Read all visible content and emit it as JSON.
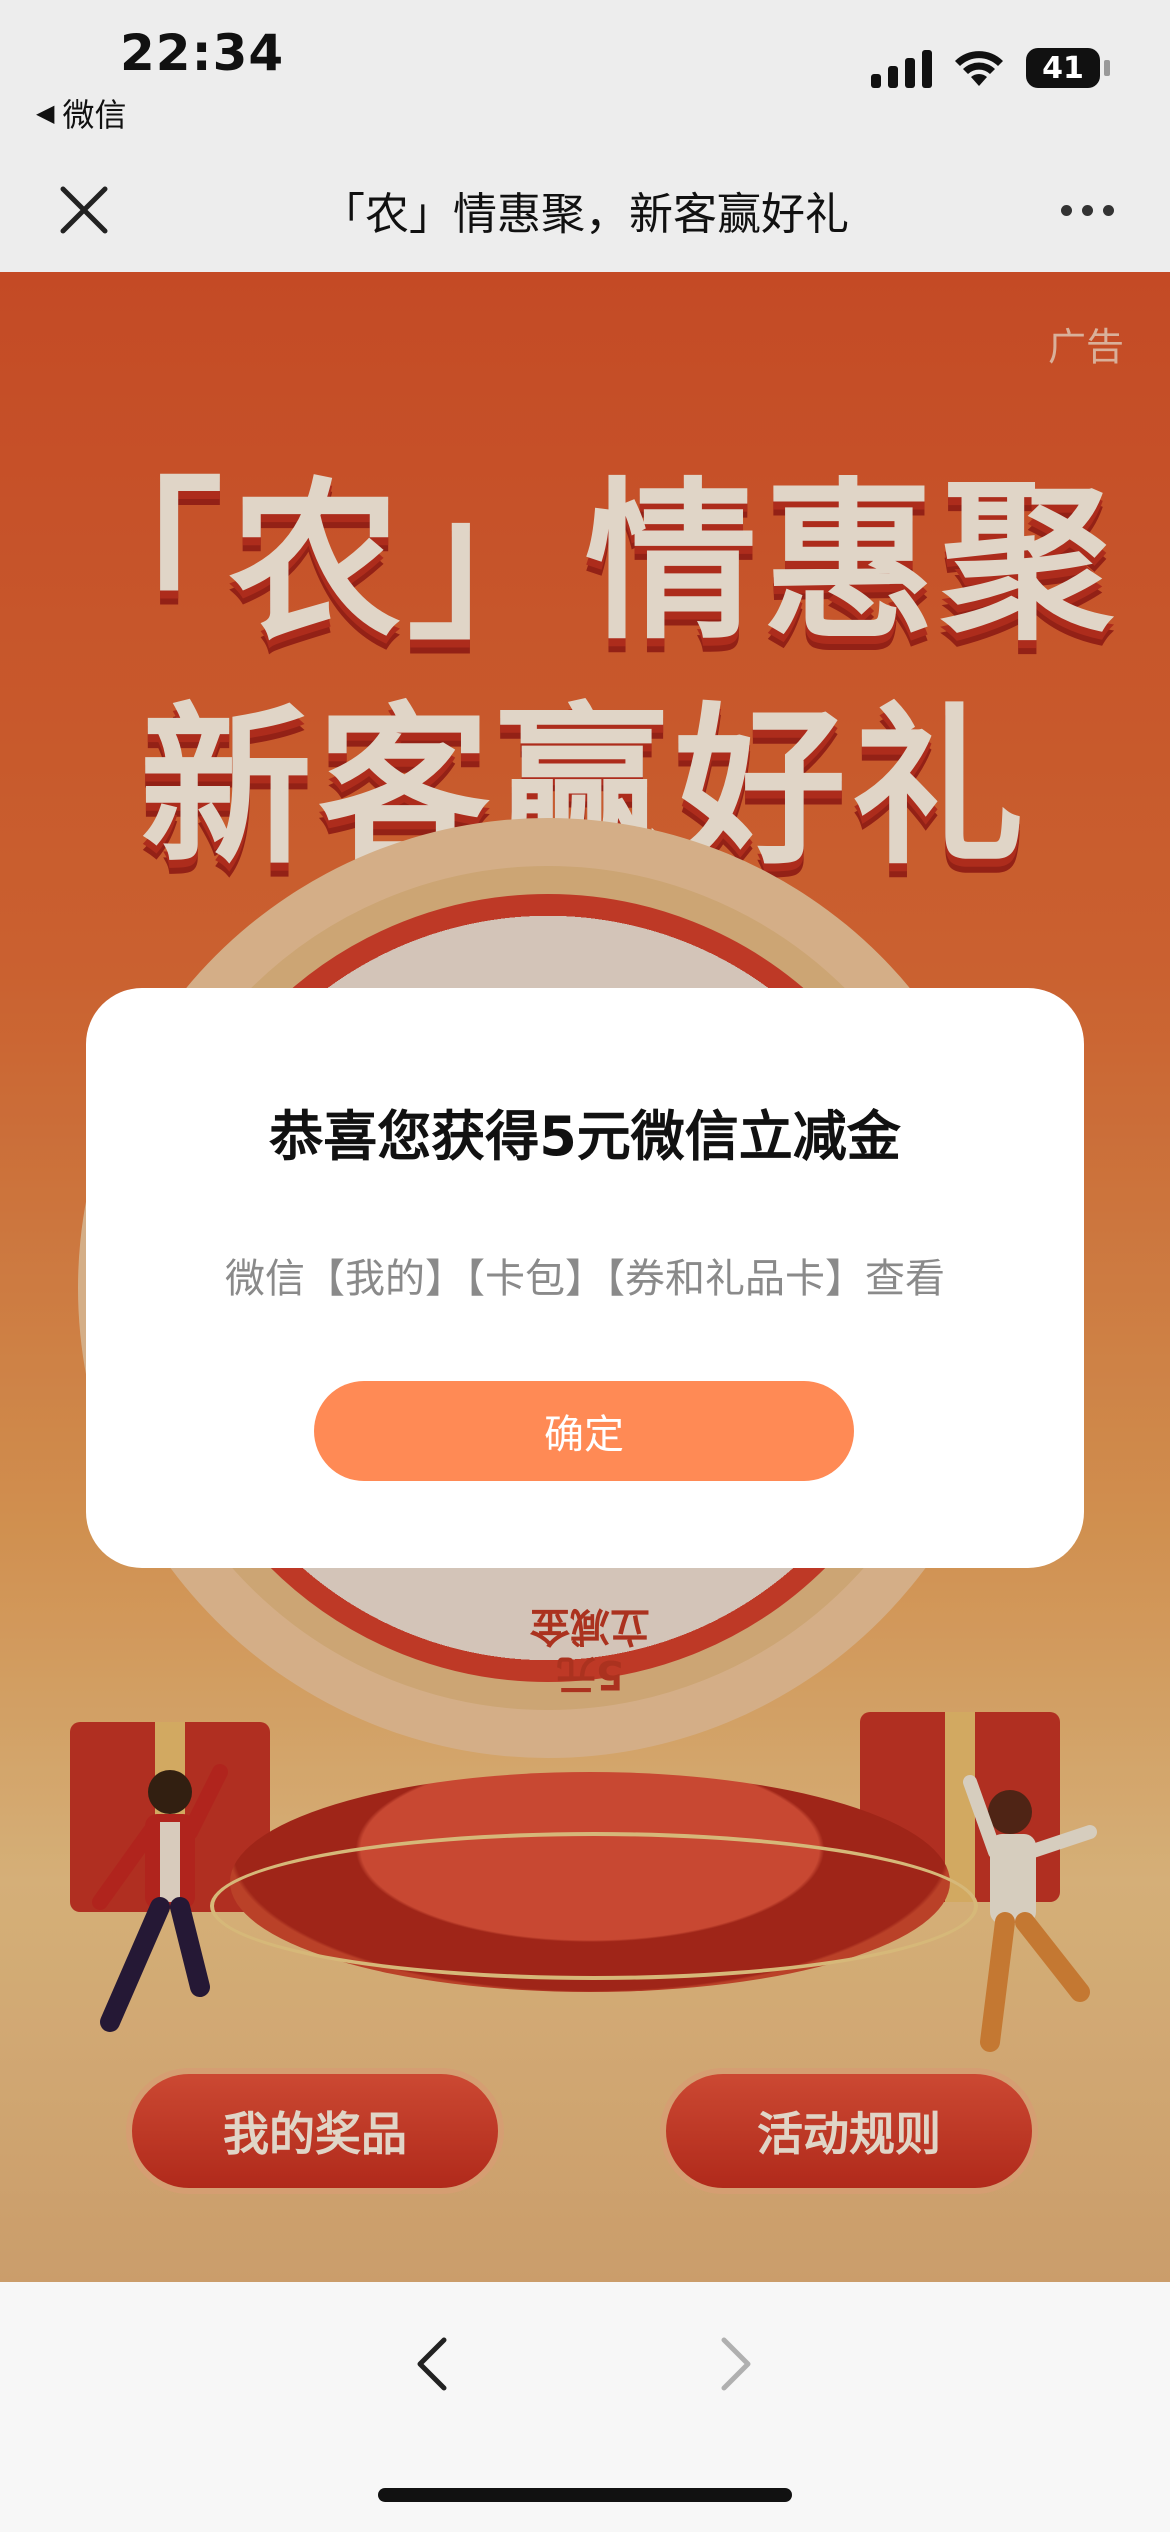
{
  "status_bar": {
    "time": "22:34",
    "back_app": "微信",
    "battery": "41",
    "icons": [
      "signal-icon",
      "wifi-icon",
      "battery-icon"
    ]
  },
  "nav": {
    "title": "「农」情惠聚，新客赢好礼",
    "icons": [
      "close-icon",
      "more-icon"
    ]
  },
  "banner": {
    "ad_label": "广告",
    "headline_line1": "「农」情惠聚",
    "headline_line2": "新客赢好礼",
    "wheel_segment_top": "5元",
    "wheel_segment_bottom": "5元\n立减金",
    "buttons": {
      "my_prizes": "我的奖品",
      "rules": "活动规则"
    }
  },
  "modal": {
    "title": "恭喜您获得5元微信立减金",
    "description": "微信【我的】【卡包】【券和礼品卡】查看",
    "confirm_label": "确定",
    "confirm_color": "#ff8a55"
  },
  "browser_bar": {
    "icons": [
      "back-arrow-icon",
      "forward-arrow-icon"
    ]
  }
}
